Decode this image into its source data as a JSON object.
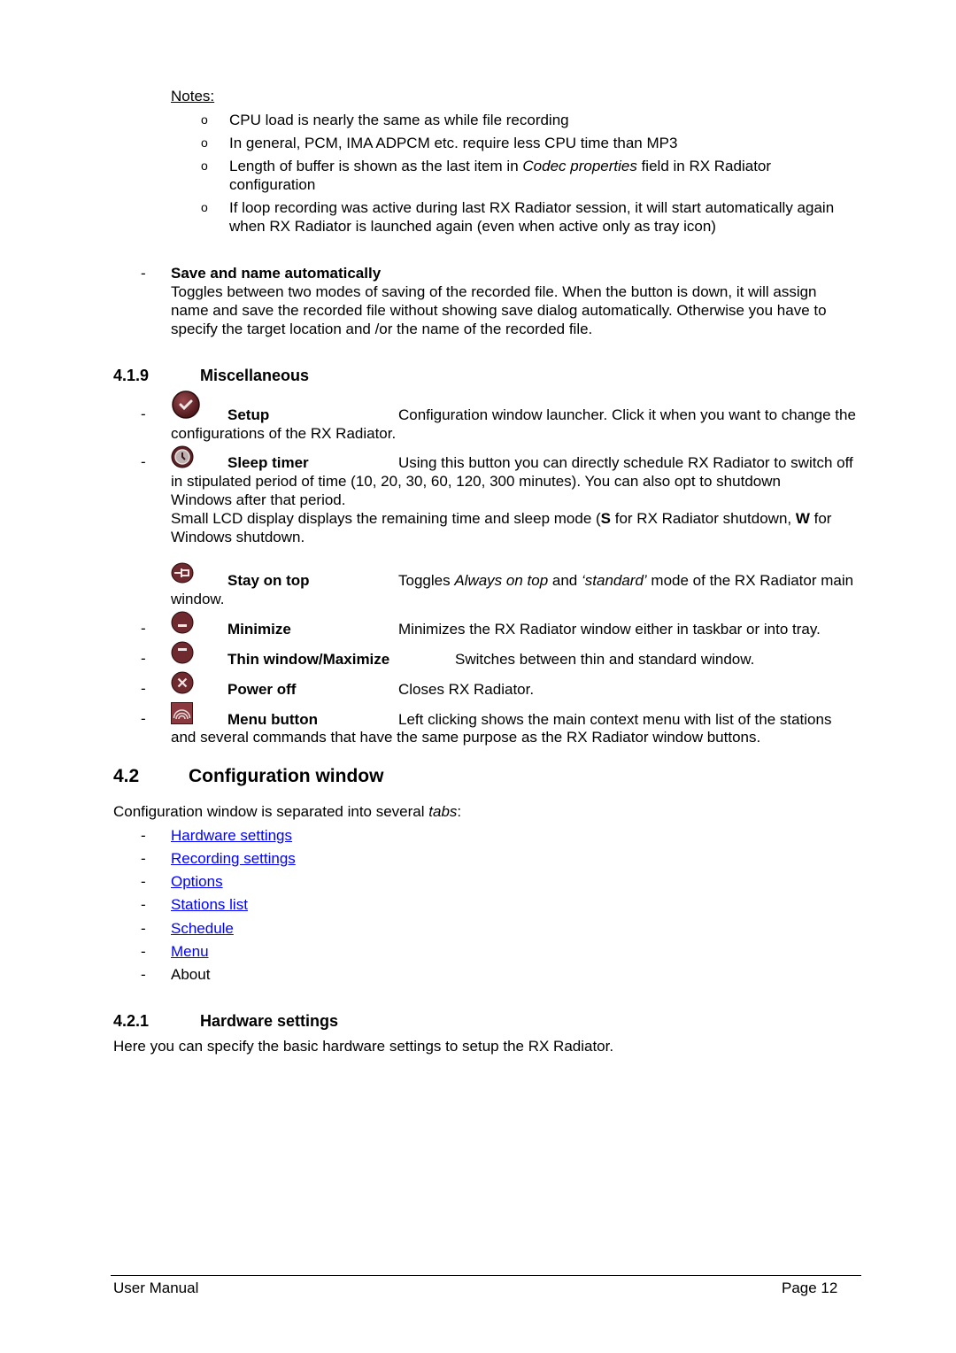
{
  "notes": {
    "label": "Notes:",
    "items": [
      {
        "lines": [
          "CPU load is nearly the same as while file recording"
        ]
      },
      {
        "lines": [
          "In general, PCM, IMA ADPCM etc. require less CPU time than MP3"
        ]
      },
      {
        "pre": "Length of buffer is shown as the last item in ",
        "em": "Codec properties",
        "post": " field in RX Radiator",
        "line2": "configuration"
      },
      {
        "lines": [
          "If loop recording was active during last RX Radiator session, it will start automatically again",
          "when RX Radiator is launched again (even when active only as tray icon)"
        ]
      }
    ]
  },
  "save_auto": {
    "dash": "-",
    "title": "Save and name automatically",
    "lines": [
      "Toggles between two modes of saving of the recorded file. When the button is down, it will assign",
      "name and save the recorded file without showing save dialog automatically. Otherwise you have to",
      "specify the target location and /or the name of the recorded file."
    ]
  },
  "misc": {
    "number": "4.1.9",
    "title": "Miscellaneous",
    "items": [
      {
        "icon": "setup-check-icon",
        "label": "Setup",
        "desc": "Configuration window launcher. Click it when you want to change the",
        "cont": [
          "configurations of the RX Radiator."
        ]
      },
      {
        "icon": "sleep-timer-clock-icon",
        "label": "Sleep timer",
        "desc": "Using this button you can directly schedule RX Radiator to switch off",
        "cont": [
          "in stipulated period of time (10, 20, 30, 60, 120, 300 minutes). You can also opt to shutdown",
          "Windows after that period."
        ]
      },
      {
        "icon": "pin-icon",
        "label": "Stay on top",
        "desc_pre": "Toggles ",
        "desc_em1": "Always on top",
        "desc_mid": " and ",
        "desc_em2": "‘standard’",
        "desc_post": " mode of the RX Radiator main",
        "cont": [
          "window."
        ]
      },
      {
        "icon": "minimize-icon",
        "label": "Minimize",
        "desc": "Minimizes the RX Radiator window either in taskbar or into tray."
      },
      {
        "icon": "thin-window-icon",
        "label": "Thin window/Maximize",
        "desc": "Switches between thin and standard window."
      },
      {
        "icon": "power-off-icon",
        "label": "Power off",
        "desc": "Closes RX Radiator."
      },
      {
        "icon": "menu-signal-icon",
        "label": "Menu button",
        "desc": "Left clicking shows the main context menu with list of the stations",
        "cont": [
          "and several commands that have the same purpose as the RX Radiator window buttons."
        ]
      }
    ],
    "lcd_line1_pre": "Small LCD display displays the remaining time and sleep mode (",
    "lcd_s": "S",
    "lcd_mid": " for RX Radiator shutdown, ",
    "lcd_w": "W",
    "lcd_post": " for",
    "lcd_line2": "Windows shutdown."
  },
  "config": {
    "number": "4.2",
    "title": "Configuration window",
    "intro_pre": "Configuration window is separated into several ",
    "intro_em": "tabs",
    "intro_post": ":",
    "tabs": [
      {
        "label": "Hardware settings",
        "link": true
      },
      {
        "label": "Recording settings",
        "link": true
      },
      {
        "label": "Options",
        "link": true
      },
      {
        "label": "Stations list",
        "link": true
      },
      {
        "label": "Schedule",
        "link": true
      },
      {
        "label": "Menu",
        "link": true
      },
      {
        "label": "About",
        "link": false
      }
    ]
  },
  "hardware": {
    "number": "4.2.1",
    "title": "Hardware settings",
    "text": "Here you can specify the basic hardware settings to setup the RX Radiator."
  },
  "footer": {
    "left": "User Manual",
    "right": "Page 12"
  },
  "colors": {
    "link": "#0000ff",
    "icon_maroon": "#6e2a2e"
  }
}
